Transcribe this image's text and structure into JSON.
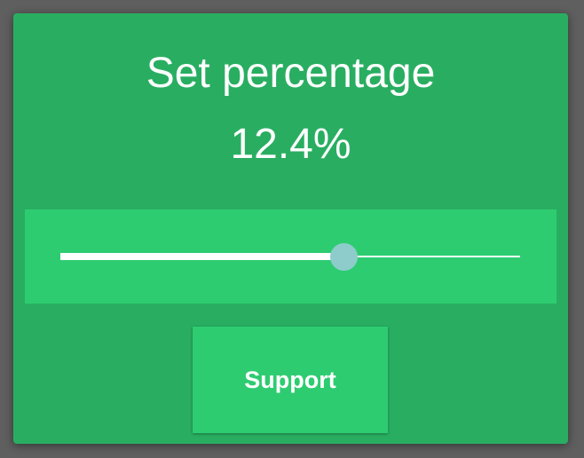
{
  "dialog": {
    "title": "Set percentage",
    "value_text": "12.4%",
    "slider": {
      "level": 0.62
    },
    "support_label": "Support"
  },
  "colors": {
    "dialog_bg": "#29ae61",
    "panel_bg": "#2ecc71",
    "thumb": "#8ecccc",
    "text": "#ffffff"
  }
}
